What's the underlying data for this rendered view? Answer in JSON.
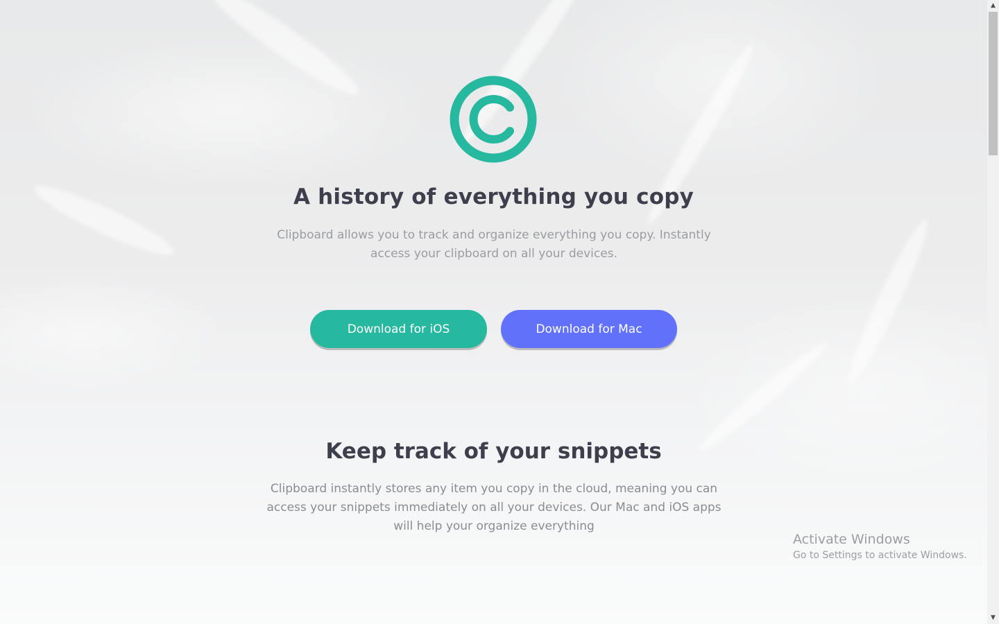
{
  "hero": {
    "logo_icon": "copyright-circle-icon",
    "accent_color": "#27b8a0",
    "title": "A history of everything you copy",
    "description": "Clipboard allows you to track and organize everything you copy. Instantly access your clipboard on all your devices.",
    "buttons": {
      "ios": {
        "label": "Download for iOS",
        "color": "#27b8a0"
      },
      "mac": {
        "label": "Download for Mac",
        "color": "#6271fa"
      }
    }
  },
  "snippets": {
    "title": "Keep track of your snippets",
    "description": "Clipboard instantly stores any item you copy in the cloud, meaning you can access your snippets immediately on all your devices. Our Mac and iOS apps will help your organize everything"
  },
  "watermark": {
    "title": "Activate Windows",
    "subtitle": "Go to Settings to activate Windows."
  },
  "scrollbar": {
    "up_icon": "arrow-up-icon",
    "down_icon": "arrow-down-icon"
  }
}
